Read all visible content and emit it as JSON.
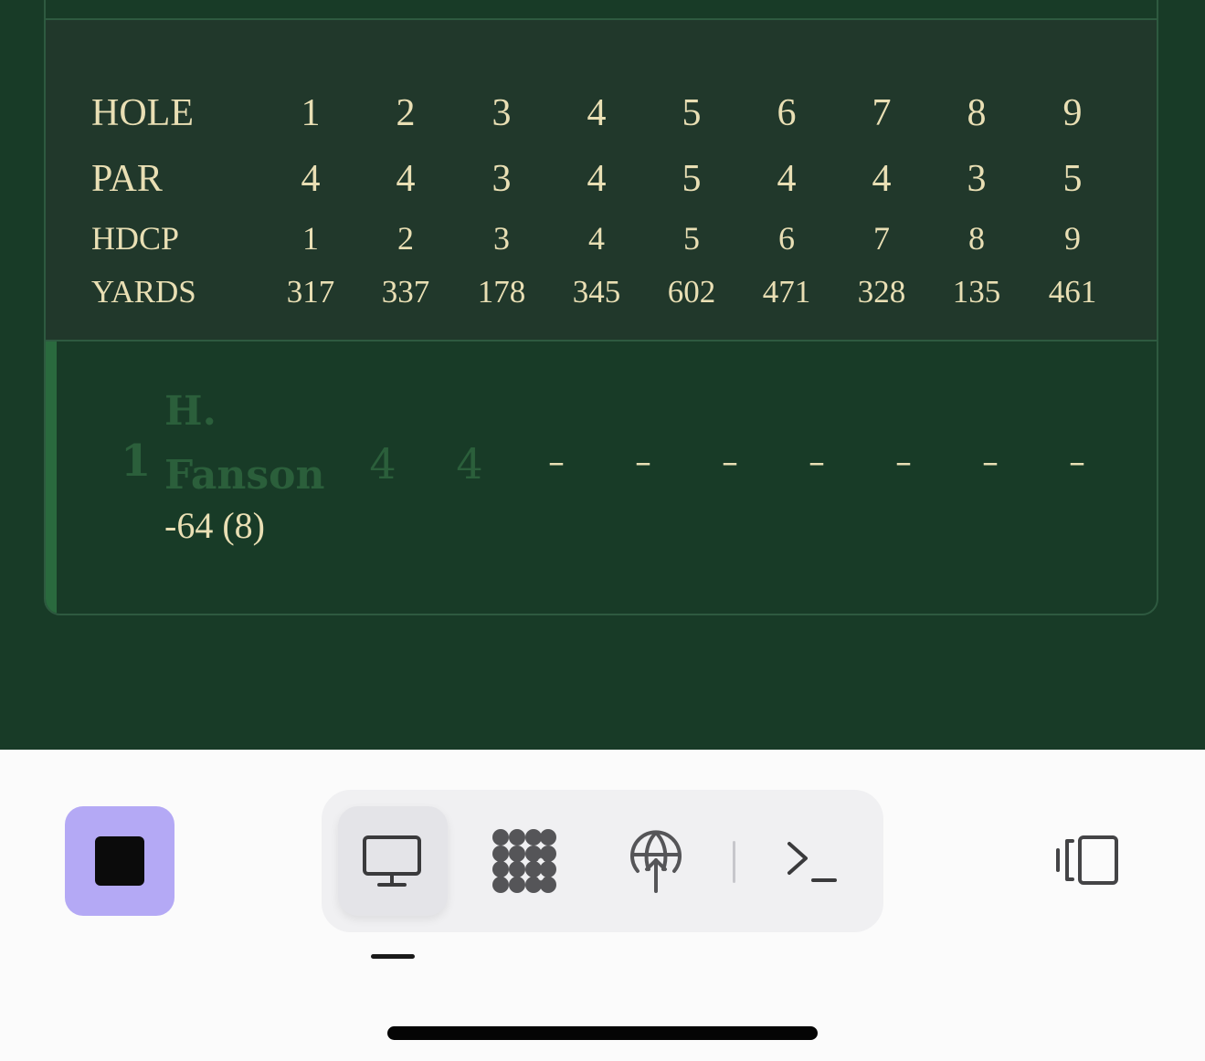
{
  "scorecard": {
    "rows": [
      {
        "label": "HOLE",
        "values": [
          "1",
          "2",
          "3",
          "4",
          "5",
          "6",
          "7",
          "8",
          "9"
        ]
      },
      {
        "label": "PAR",
        "values": [
          "4",
          "4",
          "3",
          "4",
          "5",
          "4",
          "4",
          "3",
          "5"
        ]
      },
      {
        "label": "HDCP",
        "values": [
          "1",
          "2",
          "3",
          "4",
          "5",
          "6",
          "7",
          "8",
          "9"
        ]
      },
      {
        "label": "YARDS",
        "values": [
          "317",
          "337",
          "178",
          "345",
          "602",
          "471",
          "328",
          "135",
          "461"
        ]
      }
    ]
  },
  "player": {
    "position": "1",
    "name": "H. Fanson",
    "total": "-64 (8)",
    "scores": [
      "4",
      "4",
      "–",
      "–",
      "–",
      "–",
      "–",
      "–",
      "–"
    ]
  },
  "dock": {
    "stop_icon": "stop-square-icon",
    "tabs": [
      {
        "icon": "monitor-icon",
        "active": true
      },
      {
        "icon": "pattern-grid-icon",
        "active": false
      },
      {
        "icon": "globe-upload-icon",
        "active": false
      },
      {
        "icon": "terminal-icon",
        "active": false
      }
    ],
    "side_icon": "sidebar-toggle-icon",
    "colors": {
      "stop_bg": "#b4a9f5",
      "app_bg": "#183b27"
    }
  }
}
